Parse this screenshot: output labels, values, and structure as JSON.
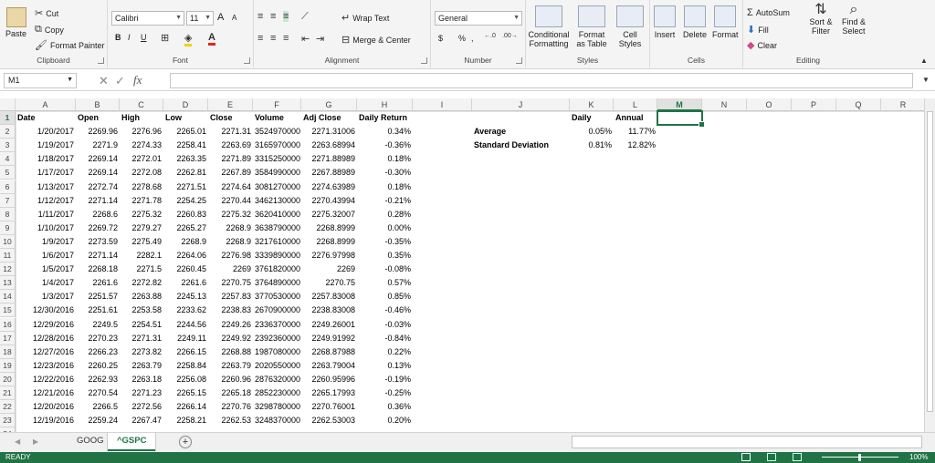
{
  "ribbon": {
    "clipboard": {
      "paste": "Paste",
      "cut": "Cut",
      "copy": "Copy",
      "format_painter": "Format Painter",
      "label": "Clipboard"
    },
    "font": {
      "name": "Calibri",
      "size": "11",
      "bold": "B",
      "italic": "I",
      "underline": "U",
      "grow": "A",
      "shrink": "A",
      "label": "Font"
    },
    "alignment": {
      "wrap_text": "Wrap Text",
      "merge_center": "Merge & Center",
      "label": "Alignment"
    },
    "number": {
      "format": "General",
      "currency": "$",
      "percent": "%",
      "comma": ",",
      "label": "Number"
    },
    "styles": {
      "conditional": "Conditional Formatting",
      "format_table": "Format as Table",
      "cell_styles": "Cell Styles",
      "label": "Styles"
    },
    "cells": {
      "insert": "Insert",
      "delete": "Delete",
      "format": "Format",
      "label": "Cells"
    },
    "editing": {
      "autosum": "AutoSum",
      "fill": "Fill",
      "clear": "Clear",
      "sort_filter": "Sort & Filter",
      "find_select": "Find & Select",
      "label": "Editing"
    }
  },
  "formula_bar": {
    "name_box": "M1",
    "fx": "fx",
    "value": ""
  },
  "columns": [
    "A",
    "B",
    "C",
    "D",
    "E",
    "F",
    "G",
    "H",
    "I",
    "J",
    "K",
    "L",
    "M",
    "N",
    "O",
    "P",
    "Q",
    "R"
  ],
  "selected_column": "M",
  "headers": [
    "Date",
    "Open",
    "High",
    "Low",
    "Close",
    "Volume",
    "Adj Close",
    "Daily Return"
  ],
  "rows": [
    [
      "1/20/2017",
      "2269.96",
      "2276.96",
      "2265.01",
      "2271.31",
      "3524970000",
      "2271.31006",
      "0.34%"
    ],
    [
      "1/19/2017",
      "2271.9",
      "2274.33",
      "2258.41",
      "2263.69",
      "3165970000",
      "2263.68994",
      "-0.36%"
    ],
    [
      "1/18/2017",
      "2269.14",
      "2272.01",
      "2263.35",
      "2271.89",
      "3315250000",
      "2271.88989",
      "0.18%"
    ],
    [
      "1/17/2017",
      "2269.14",
      "2272.08",
      "2262.81",
      "2267.89",
      "3584990000",
      "2267.88989",
      "-0.30%"
    ],
    [
      "1/13/2017",
      "2272.74",
      "2278.68",
      "2271.51",
      "2274.64",
      "3081270000",
      "2274.63989",
      "0.18%"
    ],
    [
      "1/12/2017",
      "2271.14",
      "2271.78",
      "2254.25",
      "2270.44",
      "3462130000",
      "2270.43994",
      "-0.21%"
    ],
    [
      "1/11/2017",
      "2268.6",
      "2275.32",
      "2260.83",
      "2275.32",
      "3620410000",
      "2275.32007",
      "0.28%"
    ],
    [
      "1/10/2017",
      "2269.72",
      "2279.27",
      "2265.27",
      "2268.9",
      "3638790000",
      "2268.8999",
      "0.00%"
    ],
    [
      "1/9/2017",
      "2273.59",
      "2275.49",
      "2268.9",
      "2268.9",
      "3217610000",
      "2268.8999",
      "-0.35%"
    ],
    [
      "1/6/2017",
      "2271.14",
      "2282.1",
      "2264.06",
      "2276.98",
      "3339890000",
      "2276.97998",
      "0.35%"
    ],
    [
      "1/5/2017",
      "2268.18",
      "2271.5",
      "2260.45",
      "2269",
      "3761820000",
      "2269",
      "-0.08%"
    ],
    [
      "1/4/2017",
      "2261.6",
      "2272.82",
      "2261.6",
      "2270.75",
      "3764890000",
      "2270.75",
      "0.57%"
    ],
    [
      "1/3/2017",
      "2251.57",
      "2263.88",
      "2245.13",
      "2257.83",
      "3770530000",
      "2257.83008",
      "0.85%"
    ],
    [
      "12/30/2016",
      "2251.61",
      "2253.58",
      "2233.62",
      "2238.83",
      "2670900000",
      "2238.83008",
      "-0.46%"
    ],
    [
      "12/29/2016",
      "2249.5",
      "2254.51",
      "2244.56",
      "2249.26",
      "2336370000",
      "2249.26001",
      "-0.03%"
    ],
    [
      "12/28/2016",
      "2270.23",
      "2271.31",
      "2249.11",
      "2249.92",
      "2392360000",
      "2249.91992",
      "-0.84%"
    ],
    [
      "12/27/2016",
      "2266.23",
      "2273.82",
      "2266.15",
      "2268.88",
      "1987080000",
      "2268.87988",
      "0.22%"
    ],
    [
      "12/23/2016",
      "2260.25",
      "2263.79",
      "2258.84",
      "2263.79",
      "2020550000",
      "2263.79004",
      "0.13%"
    ],
    [
      "12/22/2016",
      "2262.93",
      "2263.18",
      "2256.08",
      "2260.96",
      "2876320000",
      "2260.95996",
      "-0.19%"
    ],
    [
      "12/21/2016",
      "2270.54",
      "2271.23",
      "2265.15",
      "2265.18",
      "2852230000",
      "2265.17993",
      "-0.25%"
    ],
    [
      "12/20/2016",
      "2266.5",
      "2272.56",
      "2266.14",
      "2270.76",
      "3298780000",
      "2270.76001",
      "0.36%"
    ],
    [
      "12/19/2016",
      "2259.24",
      "2267.47",
      "2258.21",
      "2262.53",
      "3248370000",
      "2262.53003",
      "0.20%"
    ]
  ],
  "summary": {
    "daily_header": "Daily",
    "annual_header": "Annual",
    "average_label": "Average",
    "average_daily": "0.05%",
    "average_annual": "11.77%",
    "stdev_label": "Standard Deviation",
    "stdev_daily": "0.81%",
    "stdev_annual": "12.82%"
  },
  "sheet_tabs": [
    "GOOG",
    "^GSPC"
  ],
  "active_tab": "^GSPC",
  "status": {
    "mode": "READY",
    "zoom": "100%"
  },
  "colors": {
    "accent": "#217346"
  }
}
